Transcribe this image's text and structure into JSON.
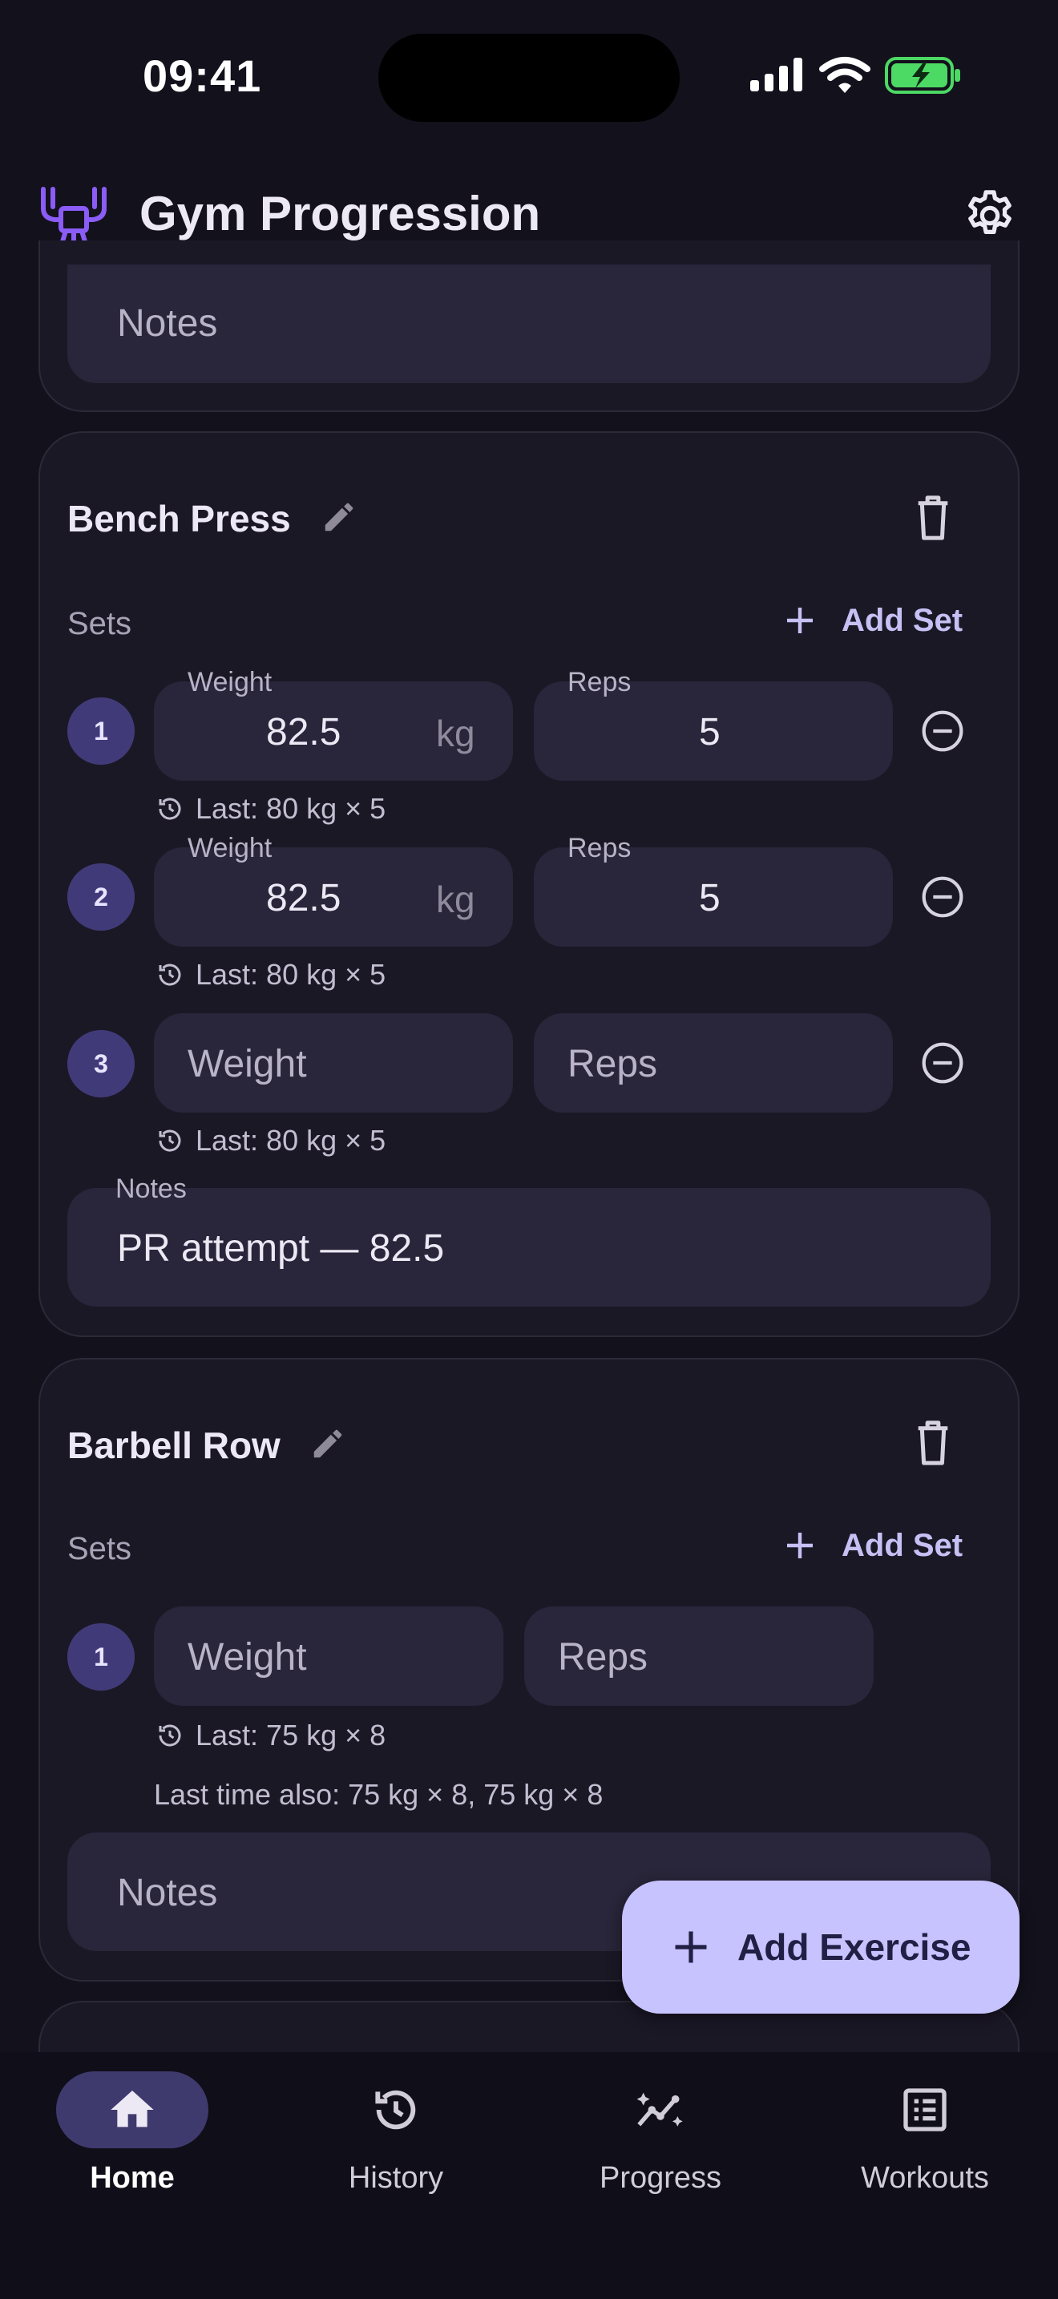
{
  "status_bar": {
    "time": "09:41"
  },
  "app_bar": {
    "title": "Gym Progression",
    "settings_icon": "gear-icon",
    "logo_icon": "dumbbell-logo-icon"
  },
  "colors": {
    "accent": "#c7c3ff",
    "badge": "#403b78",
    "background": "#13111c",
    "card": "#1b1826",
    "battery": "#4cd964"
  },
  "top_card": {
    "notes_placeholder": "Notes"
  },
  "exercises": [
    {
      "name": "Bench Press",
      "sets_label": "Sets",
      "add_set_label": "Add Set",
      "sets": [
        {
          "number": "1",
          "weight_label": "Weight",
          "weight": "82.5",
          "unit": "kg",
          "reps_label": "Reps",
          "reps": "5",
          "last": "Last: 80 kg × 5"
        },
        {
          "number": "2",
          "weight_label": "Weight",
          "weight": "82.5",
          "unit": "kg",
          "reps_label": "Reps",
          "reps": "5",
          "last": "Last: 80 kg × 5"
        },
        {
          "number": "3",
          "weight_placeholder": "Weight",
          "reps_placeholder": "Reps",
          "last": "Last: 80 kg × 5"
        }
      ],
      "notes_label": "Notes",
      "notes": "PR attempt — 82.5"
    },
    {
      "name": "Barbell Row",
      "sets_label": "Sets",
      "add_set_label": "Add Set",
      "sets": [
        {
          "number": "1",
          "weight_placeholder": "Weight",
          "reps_placeholder": "Reps",
          "last": "Last: 75 kg × 8"
        }
      ],
      "also": "Last time also: 75 kg × 8, 75 kg × 8",
      "notes_placeholder": "Notes"
    }
  ],
  "fab": {
    "label": "Add Exercise"
  },
  "bottom_nav": [
    {
      "label": "Home",
      "icon": "home-icon",
      "active": true
    },
    {
      "label": "History",
      "icon": "history-icon",
      "active": false
    },
    {
      "label": "Progress",
      "icon": "progress-chart-icon",
      "active": false
    },
    {
      "label": "Workouts",
      "icon": "list-icon",
      "active": false
    }
  ]
}
